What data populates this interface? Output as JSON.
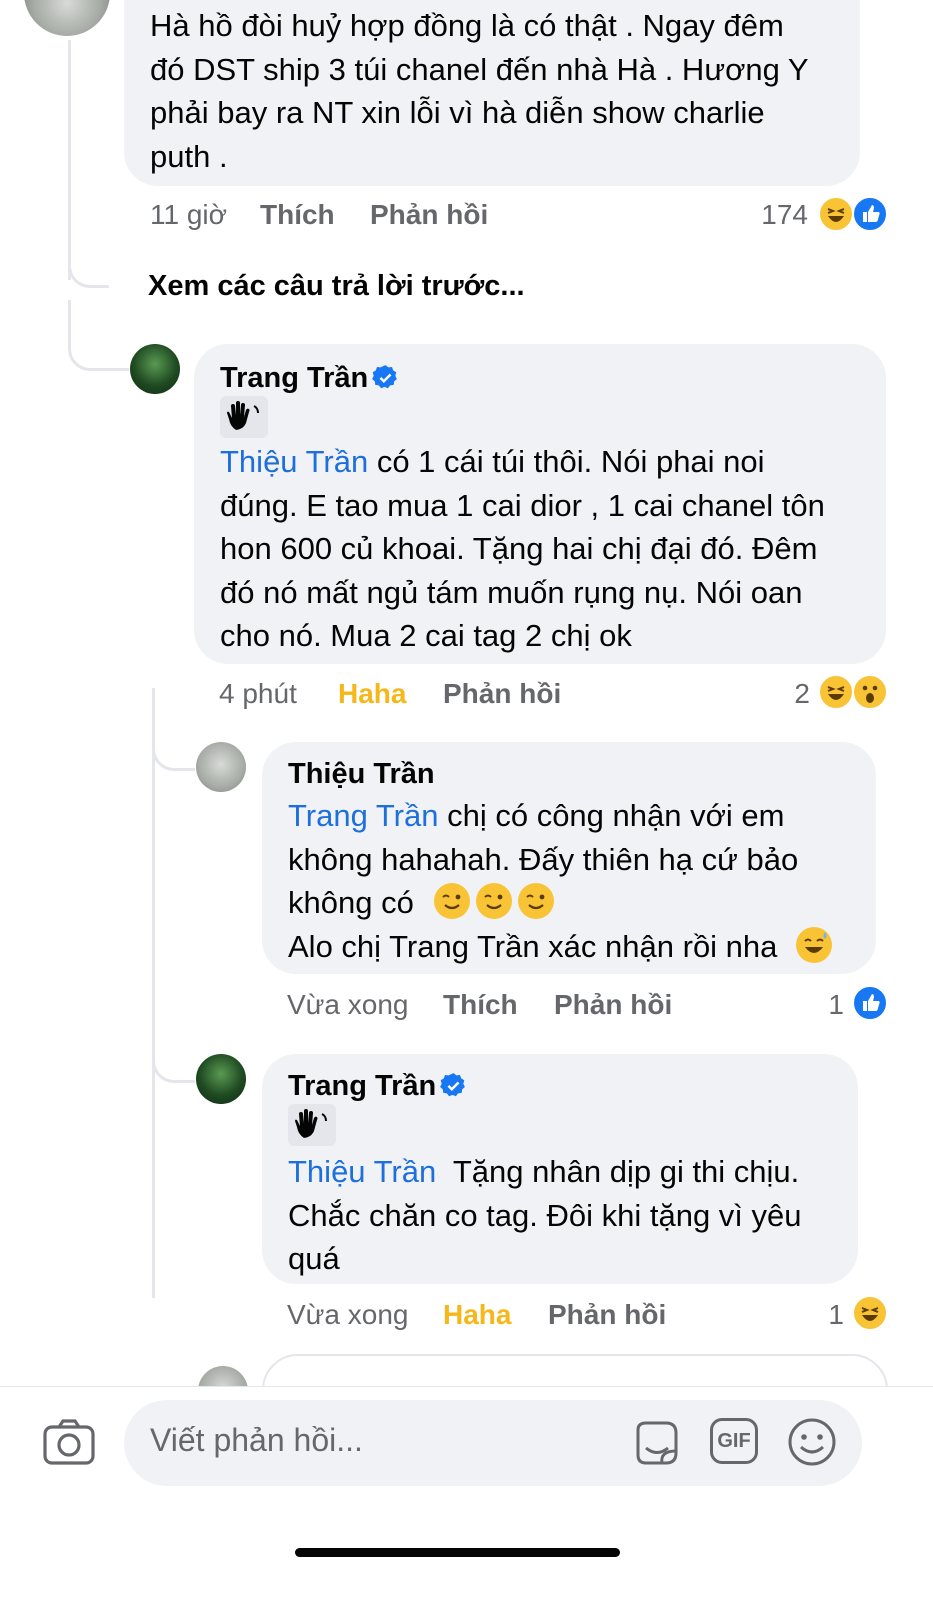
{
  "comment_top": {
    "lines": [
      "Hà hồ đòi huỷ hợp đồng là có thật . Ngay đêm",
      "đó DST ship 3 túi chanel đến nhà Hà . Hương Y",
      "phải bay ra NT xin lỗi vì hà diễn show charlie",
      "puth ."
    ],
    "time": "11 giờ",
    "like_label": "Thích",
    "reply_label": "Phản hồi",
    "reaction_count": "174"
  },
  "view_previous": "Xem các câu trả lời trước...",
  "reply_1": {
    "name": "Trang Trần",
    "mention": "Thiệu Trần",
    "first_line_rest": " có 1 cái túi thôi. Nói phai noi",
    "lines": [
      "đúng. E tao mua 1 cai dior , 1 cai chanel tôn",
      "hon 600 củ khoai.  Tặng hai chị đại đó. Đêm",
      "đó nó mất ngủ tám muốn rụng nụ. Nói oan",
      "cho nó. Mua 2 cai tag 2 chị ok"
    ],
    "time": "4 phút",
    "reaction_label": "Haha",
    "reply_label": "Phản hồi",
    "reaction_count": "2"
  },
  "reply_2": {
    "name": "Thiệu Trần",
    "mention": "Trang Trần",
    "first_line_rest": " chị có công nhận với em",
    "line2": "không hahahah. Đấy thiên hạ cứ bảo",
    "line3": "không có",
    "line4": "Alo chị Trang Trần xác nhận rồi nha",
    "time": "Vừa xong",
    "like_label": "Thích",
    "reply_label": "Phản hồi",
    "reaction_count": "1"
  },
  "reply_3": {
    "name": "Trang Trần",
    "mention": "Thiệu Trần",
    "first_line_rest": "  Tặng nhân dịp gi thi chịu.",
    "lines": [
      "Chắc chăn co tag. Đôi khi tặng vì yêu",
      "quá"
    ],
    "time": "Vừa xong",
    "reaction_label": "Haha",
    "reply_label": "Phản hồi",
    "reaction_count": "1"
  },
  "composer": {
    "placeholder": "Viết phản hồi...",
    "gif_label": "GIF"
  },
  "colors": {
    "bubble": "#f0f2f5",
    "mention": "#1d6fdb",
    "haha": "#f5b71a",
    "meta": "#65676b",
    "like": "#1877f2"
  }
}
